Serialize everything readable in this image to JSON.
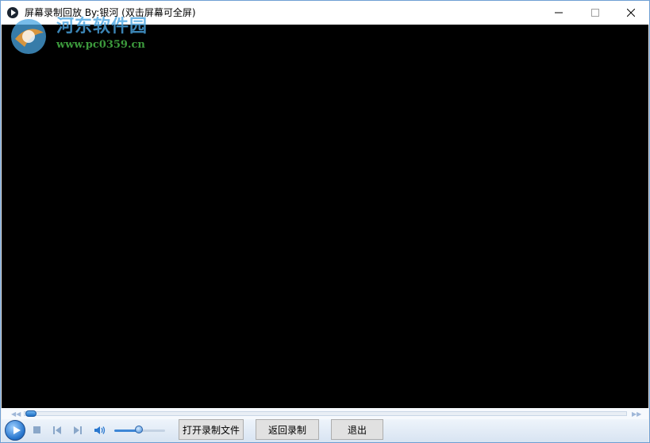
{
  "window": {
    "title": "屏幕录制回放 By:银河 (双击屏幕可全屏)"
  },
  "watermark": {
    "site_name": "河东软件园",
    "url": "www.pc0359.cn"
  },
  "window_controls": {
    "minimize_icon": "minimize-icon",
    "maximize_icon": "maximize-icon",
    "close_icon": "close-icon"
  },
  "player": {
    "seek_progress": 0,
    "volume_level": 0.5,
    "icons": [
      "play-icon",
      "stop-icon",
      "previous-icon",
      "next-icon",
      "speaker-icon"
    ]
  },
  "buttons": {
    "open_file": "打开录制文件",
    "back_to_record": "返回录制",
    "exit": "退出"
  },
  "colors": {
    "video_bg": "#000000",
    "accent": "#2a78cf"
  }
}
